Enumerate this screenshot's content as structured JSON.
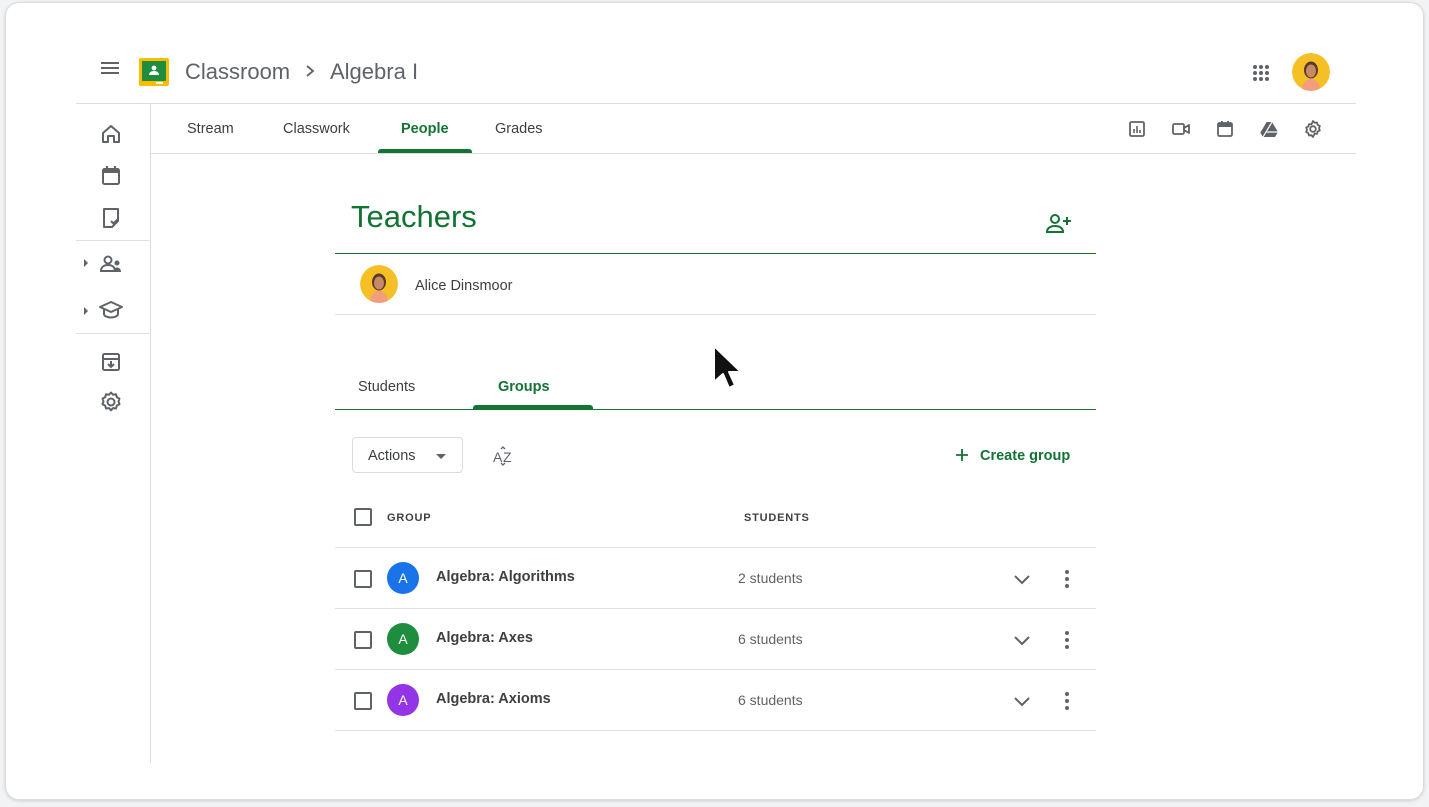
{
  "header": {
    "brand": "Classroom",
    "separator": "›",
    "class_name": "Algebra I"
  },
  "tabs": [
    {
      "label": "Stream"
    },
    {
      "label": "Classwork"
    },
    {
      "label": "People"
    },
    {
      "label": "Grades"
    }
  ],
  "active_tab": "People",
  "teachers": {
    "title": "Teachers",
    "list": [
      {
        "name": "Alice Dinsmoor"
      }
    ]
  },
  "people_tabs": [
    {
      "label": "Students"
    },
    {
      "label": "Groups"
    }
  ],
  "active_people_tab": "Groups",
  "toolbar": {
    "actions_label": "Actions",
    "create_group_label": "Create group"
  },
  "table": {
    "col_group": "GROUP",
    "col_students": "STUDENTS",
    "rows": [
      {
        "letter": "A",
        "name": "Algebra: Algorithms",
        "students": "2 students",
        "color": "#1a73e8"
      },
      {
        "letter": "A",
        "name": "Algebra: Axes",
        "students": "6 students",
        "color": "#1e8e3e"
      },
      {
        "letter": "A",
        "name": "Algebra: Axioms",
        "students": "6 students",
        "color": "#9334e6"
      }
    ]
  },
  "colors": {
    "accent": "#137333",
    "logo_yellow": "#fbbc04",
    "logo_green": "#1e8e3e"
  },
  "icons": {
    "nav": [
      "home-icon",
      "calendar-icon",
      "todo-icon",
      "teaching-icon",
      "enrolled-icon",
      "archived-icon",
      "settings-icon"
    ],
    "tools": [
      "gradebook-icon",
      "meet-icon",
      "calendar-icon",
      "drive-icon",
      "settings-icon"
    ]
  }
}
